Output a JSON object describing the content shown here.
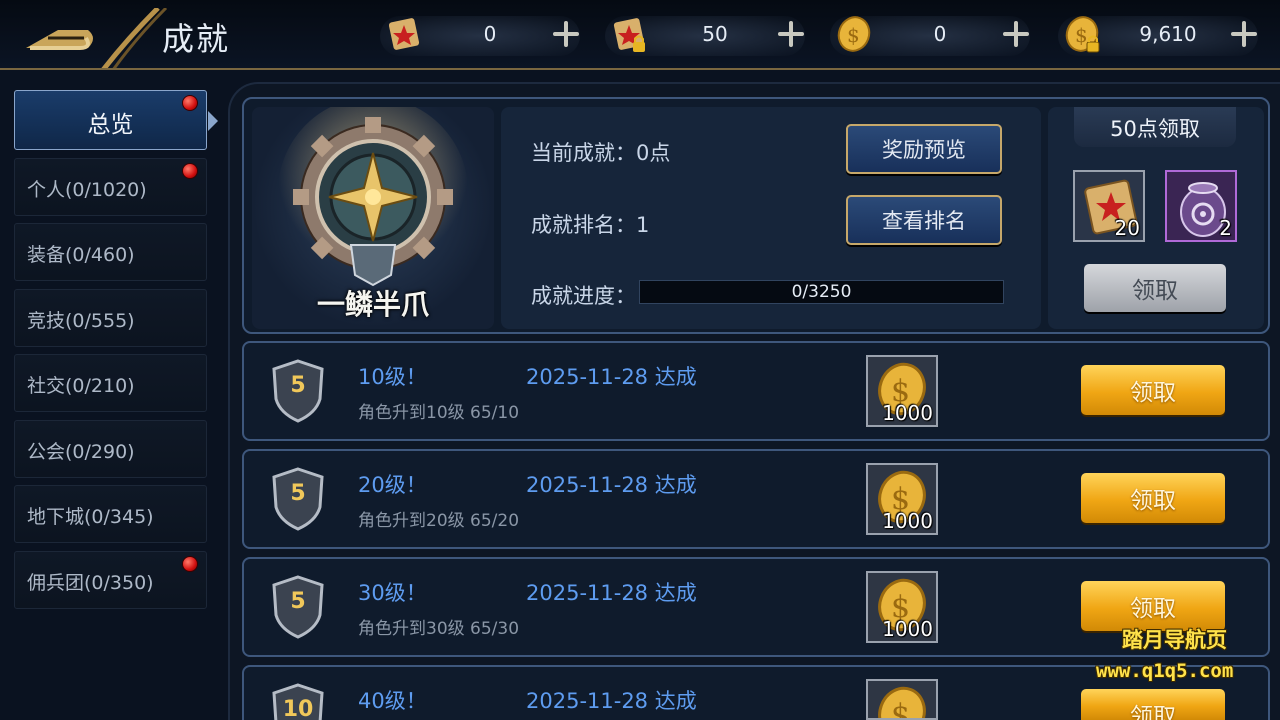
{
  "header": {
    "title": "成就",
    "back_icon": "back-arrow-icon",
    "currencies": [
      {
        "name": "summon-scroll-icon",
        "value": "0"
      },
      {
        "name": "locked-summon-scroll-icon",
        "value": "50"
      },
      {
        "name": "gold-coin-icon",
        "value": "0"
      },
      {
        "name": "locked-gold-coin-icon",
        "value": "9,610"
      }
    ]
  },
  "sidebar": {
    "items": [
      {
        "label": "总览",
        "active": true,
        "dot": true
      },
      {
        "label": "个人(0/1020)",
        "dot": true
      },
      {
        "label": "装备(0/460)",
        "dot": false
      },
      {
        "label": "竞技(0/555)",
        "dot": false
      },
      {
        "label": "社交(0/210)",
        "dot": false
      },
      {
        "label": "公会(0/290)",
        "dot": false
      },
      {
        "label": "地下城(0/345)",
        "dot": false
      },
      {
        "label": "佣兵团(0/350)",
        "dot": true
      }
    ]
  },
  "summary": {
    "badge_name": "一鳞半爪",
    "current_points": "当前成就：0点",
    "rank": "成就排名：1",
    "progress_label": "成就进度：",
    "progress_text": "0/3250",
    "progress_fraction": 0,
    "preview_button": "奖励预览",
    "rank_button": "查看排名",
    "reward_title": "50点领取",
    "reward_items": [
      {
        "icon": "summon-scroll-icon",
        "count": "20"
      },
      {
        "icon": "purple-orb-jar-icon",
        "count": "2"
      }
    ],
    "claim_button": "领取"
  },
  "achievements": [
    {
      "level_badge": "5",
      "title": "10级！",
      "date": "2025-11-28 达成",
      "desc": "角色升到10级 65/10",
      "reward_count": "1000",
      "button": "领取"
    },
    {
      "level_badge": "5",
      "title": "20级！",
      "date": "2025-11-28 达成",
      "desc": "角色升到20级 65/20",
      "reward_count": "1000",
      "button": "领取"
    },
    {
      "level_badge": "5",
      "title": "30级！",
      "date": "2025-11-28 达成",
      "desc": "角色升到30级 65/30",
      "reward_count": "1000",
      "button": "领取"
    },
    {
      "level_badge": "10",
      "title": "40级！",
      "date": "2025-11-28 达成",
      "desc": "",
      "reward_count": "",
      "button": "领取"
    }
  ],
  "watermark": {
    "line1": "踏月导航页",
    "line2": "www.q1q5.com"
  },
  "colors": {
    "accent_gold": "#f0a614",
    "link_blue": "#5e9cf0",
    "frame_blue": "#3e577c"
  }
}
